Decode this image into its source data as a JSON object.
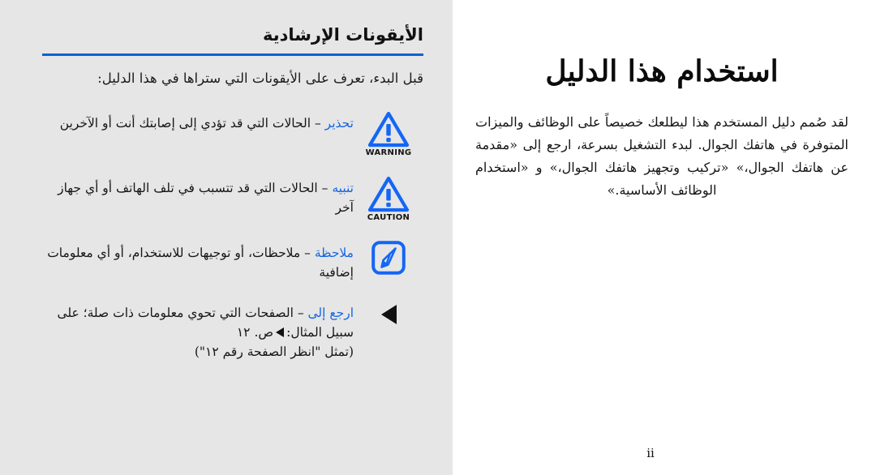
{
  "colors": {
    "left_panel_bg": "#e6e6e6",
    "right_panel_bg": "#ffffff",
    "rule_blue": "#0a62d0",
    "keyword_blue": "#1666e0",
    "icon_blue": "#1466f5",
    "text_black": "#141414"
  },
  "left_panel": {
    "heading": "الأيقونات الإرشادية",
    "intro": "قبل البدء، تعرف على الأيقونات التي ستراها في هذا الدليل:",
    "rows": [
      {
        "keyword": "تحذير",
        "dash": " – ",
        "text": "الحالات التي قد تؤدي إلى إصابتك أنت أو الآخرين",
        "icon": "warning-triangle-icon",
        "caption": "WARNING"
      },
      {
        "keyword": "تنبيه",
        "dash": " – ",
        "text": "الحالات التي قد تتسبب في تلف الهاتف أو أي جهاز آخر",
        "icon": "caution-triangle-icon",
        "caption": "CAUTION"
      },
      {
        "keyword": "ملاحظة",
        "dash": " – ",
        "text": "ملاحظات، أو توجيهات للاستخدام، أو أي معلومات إضافية",
        "icon": "note-pencil-icon",
        "caption": ""
      },
      {
        "keyword": "ارجع إلى",
        "dash": " – ",
        "text_before_arrow": "الصفحات التي تحوي معلومات ذات صلة؛ على سبيل المثال:",
        "text_after_arrow": "ص. ١٢",
        "text_parenthetical": "(تمثل \"انظر الصفحة رقم ١٢\")",
        "icon": "left-arrow-icon",
        "caption": ""
      }
    ]
  },
  "right_panel": {
    "title": "استخدام هذا الدليل",
    "body": "لقد صُمم دليل المستخدم هذا ليطلعك خصيصاً على الوظائف والميزات المتوفرة في هاتفك الجوال. لبدء التشغيل بسرعة، ارجع إلى «مقدمة عن هاتفك الجوال،» «تركيب وتجهيز هاتفك الجوال،» و «استخدام الوظائف الأساسية.»",
    "folio": "ii"
  }
}
